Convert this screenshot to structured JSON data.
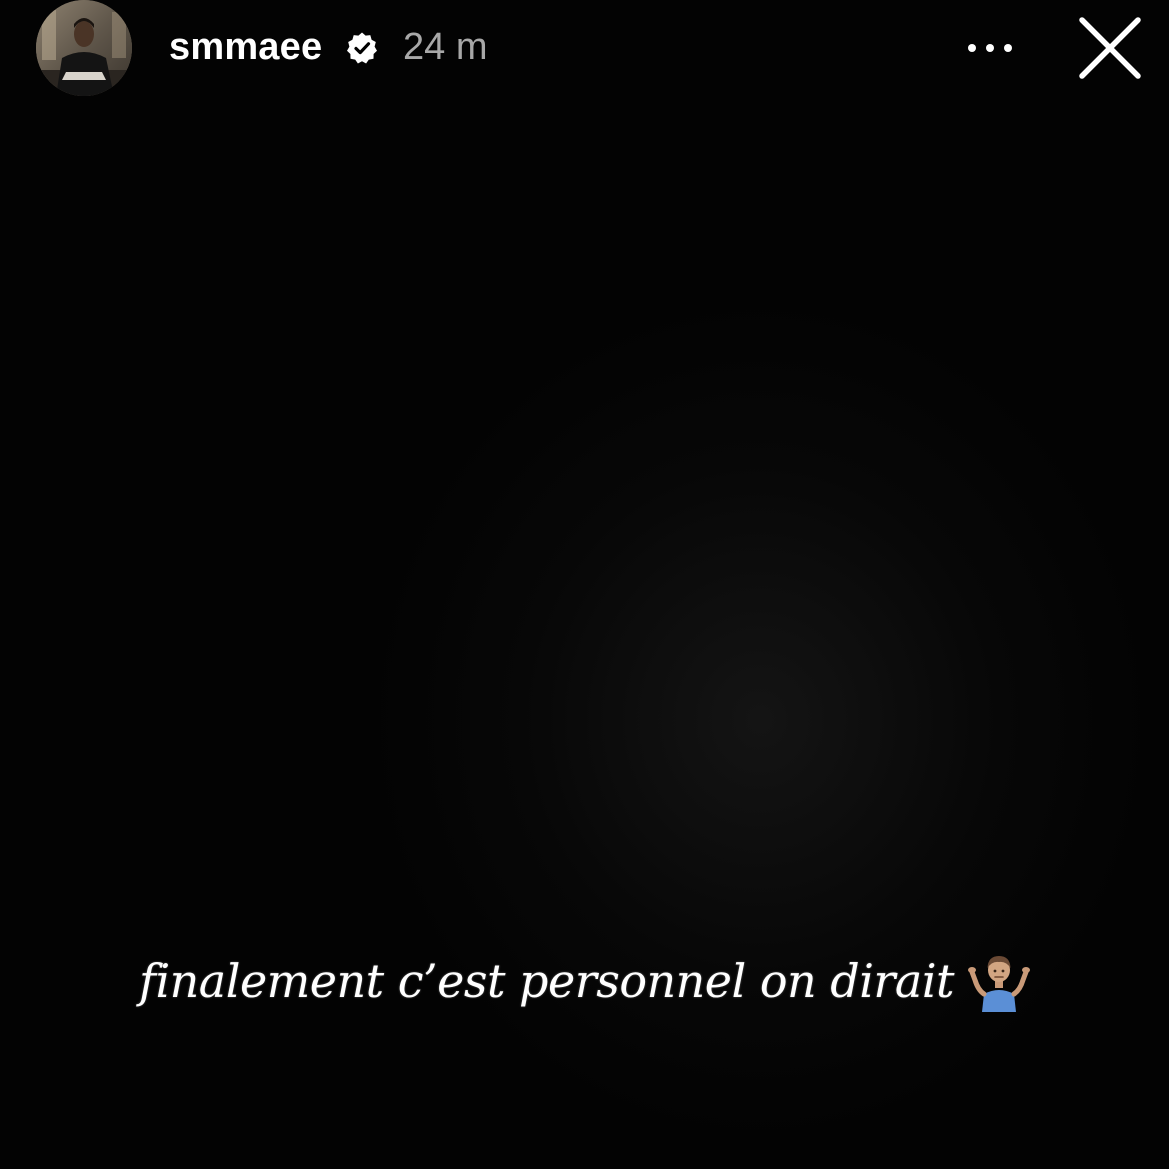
{
  "header": {
    "username": "smmaee",
    "verified_badge_icon": "verified-badge-icon",
    "time_ago": "24 m",
    "more_icon": "more-horizontal-icon",
    "close_icon": "close-icon"
  },
  "story": {
    "caption": "finalement c’est personnel on dirait",
    "caption_emoji_icon": "person-shrugging-icon"
  },
  "colors": {
    "background": "#000000",
    "text": "#ffffff",
    "time_text": "#a8a8a8"
  }
}
